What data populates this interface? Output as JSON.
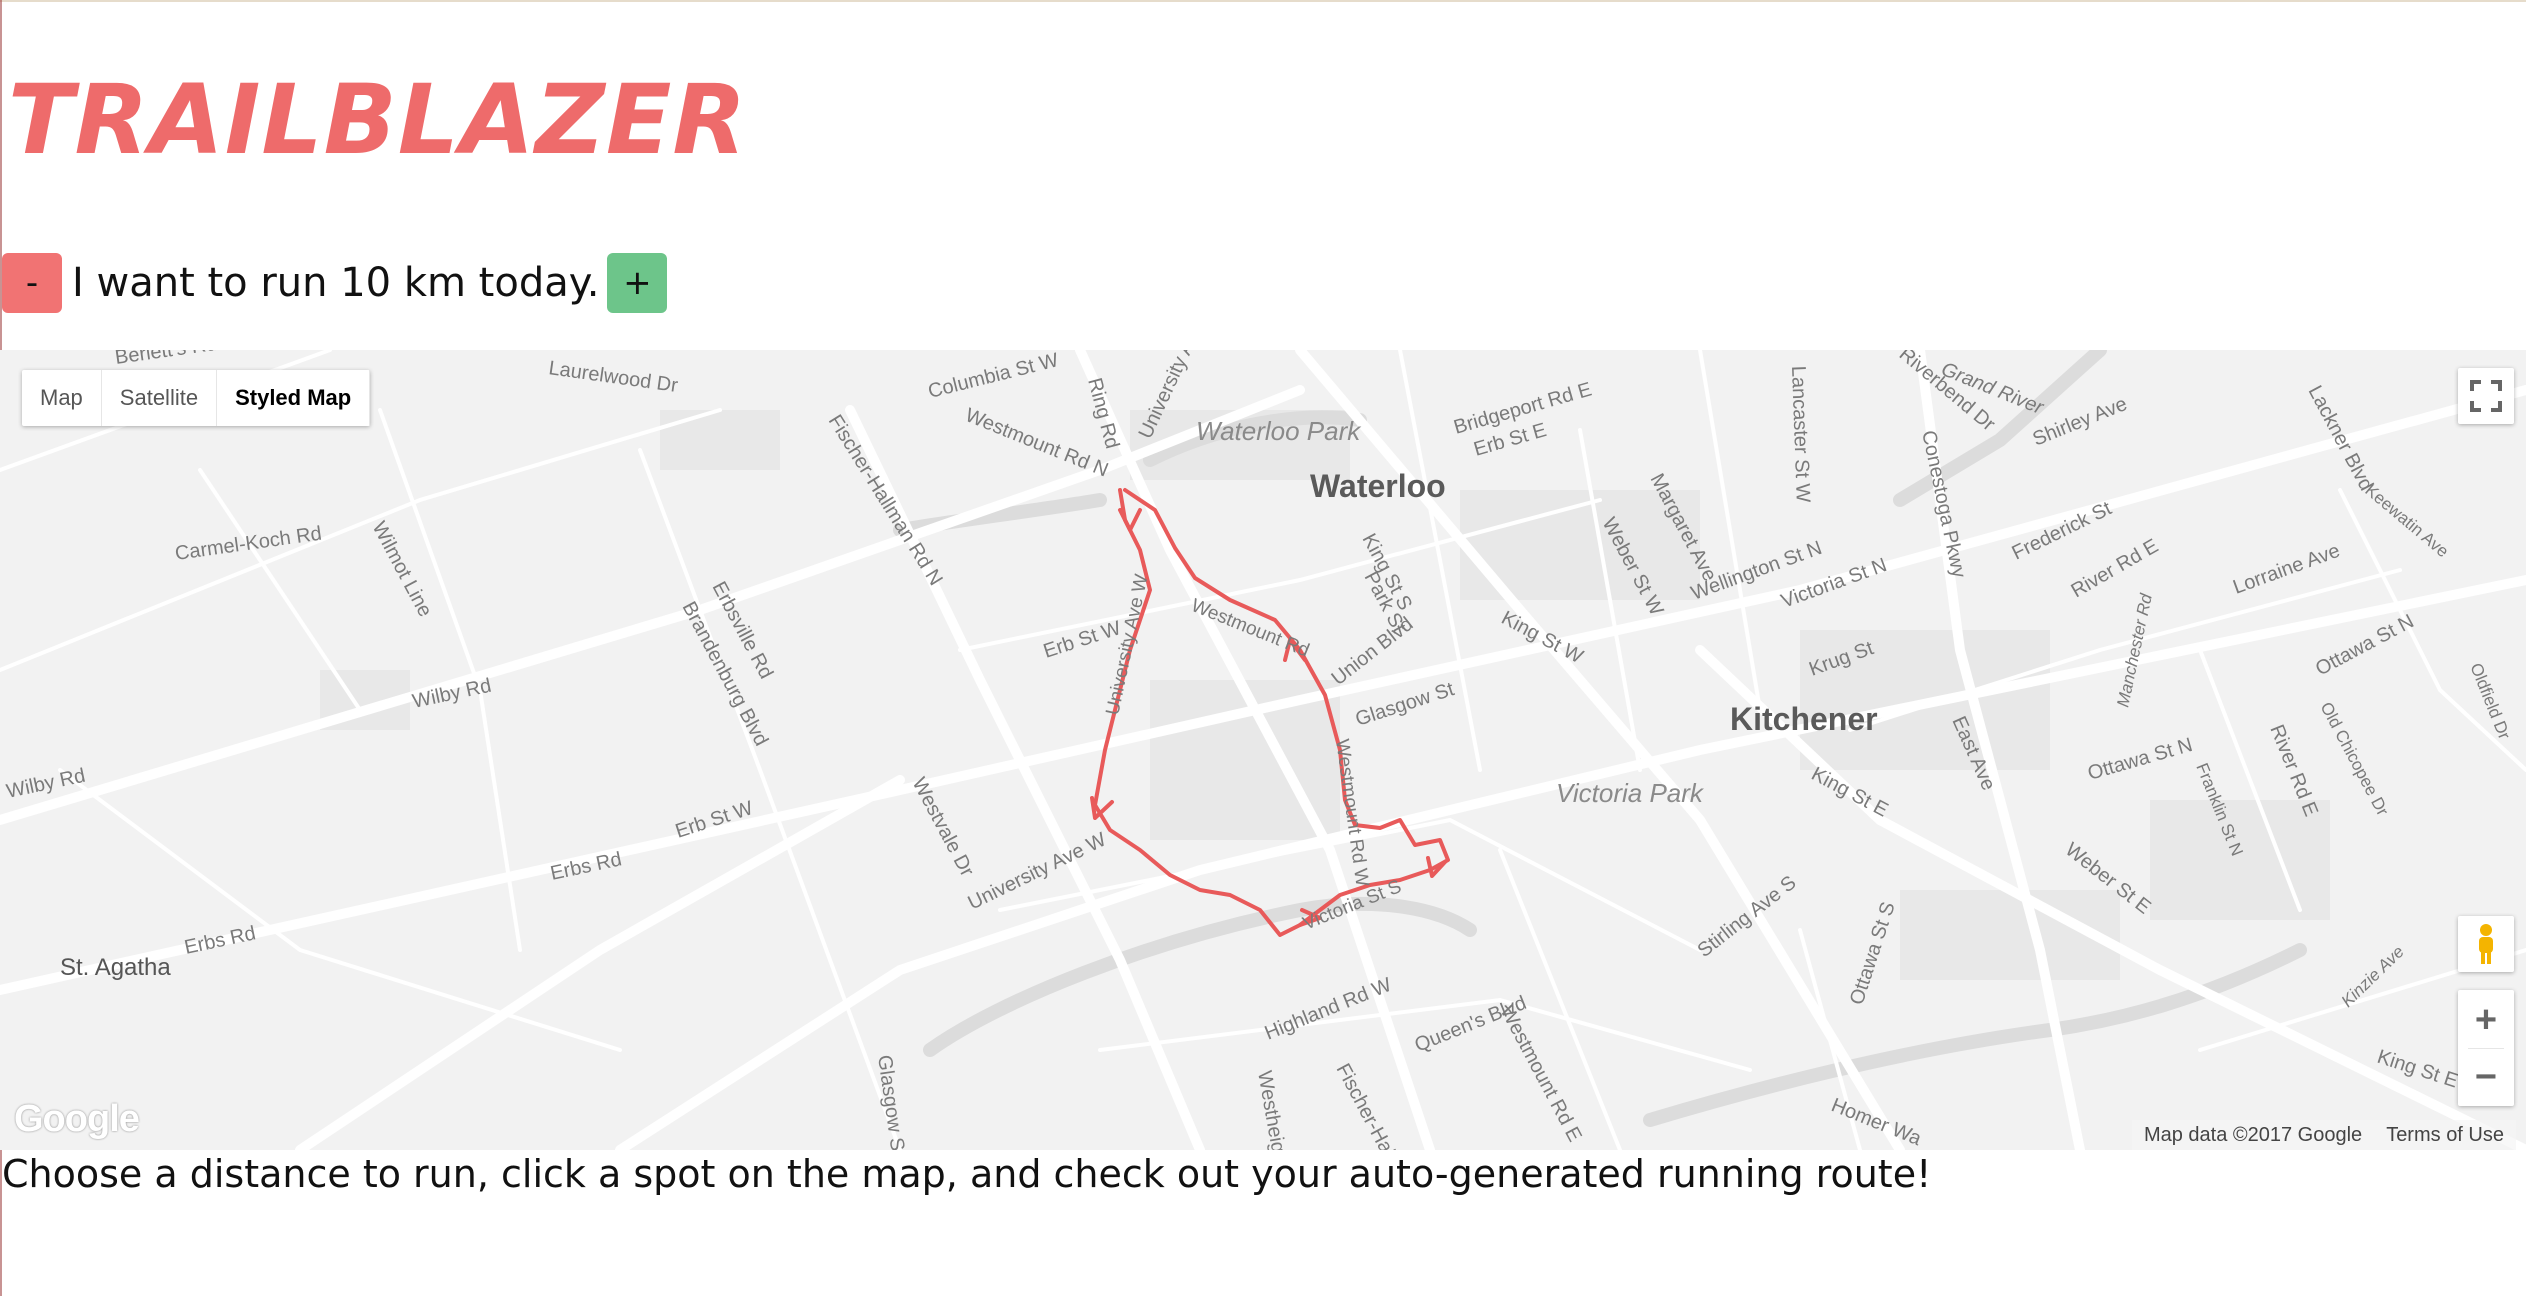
{
  "app": {
    "brand": "TRAILBLAZER"
  },
  "controls": {
    "decrease_label": "-",
    "increase_label": "+",
    "distance_text": "I want to run 10 km today."
  },
  "map": {
    "type_buttons": [
      "Map",
      "Satellite",
      "Styled Map"
    ],
    "active_type": "Styled Map",
    "zoom_in_label": "+",
    "zoom_out_label": "−",
    "logo_text": "Google",
    "attribution": "Map data ©2017 Google",
    "terms": "Terms of Use",
    "route_color": "#e85a5a",
    "labels": {
      "waterloo": "Waterloo",
      "kitchener": "Kitchener",
      "waterloo_park": "Waterloo Park",
      "victoria_park": "Victoria Park",
      "st_agatha": "St. Agatha",
      "berletts": "Berlett's Rd",
      "laurelwood": "Laurelwood Dr",
      "columbia": "Columbia St W",
      "ring_rd": "Ring Rd",
      "university_ave_e": "University Ave W",
      "westmount_rd_n": "Westmount Rd N",
      "fischer_hallman_n": "Fischer-Hallman Rd N",
      "carmel_koch": "Carmel-Koch Rd",
      "wilmot_line": "Wilmot Line",
      "erbsville": "Erbsville Rd",
      "brandenburg": "Brandenburg Blvd",
      "wilby_1": "Wilby Rd",
      "wilby_2": "Wilby Rd",
      "erb_st_w": "Erb St W",
      "erb_st_w2": "Erb St W",
      "erbs_rd": "Erbs Rd",
      "erbs_rd2": "Erbs Rd",
      "westvale": "Westvale Dr",
      "university_ave_w": "University Ave W",
      "glasgow_st": "Glasgow St",
      "glasgow_st2": "Glasgow St",
      "highland": "Highland Rd W",
      "queens": "Queen's Blvd",
      "westmount_rd_e": "Westmount Rd E",
      "fischer_hall": "Fischer-Hall",
      "westheights": "Westheig",
      "bridgeport": "Bridgeport Rd E",
      "erb_st_e": "Erb St E",
      "lancaster": "Lancaster St W",
      "riverbend": "Riverbend Dr",
      "grand_river": "Grand River",
      "shirley": "Shirley Ave",
      "lackner": "Lackner Blvd",
      "keewatin": "Keewatin Ave",
      "conestoga": "Conestoga Pkwy",
      "margaret": "Margaret Ave",
      "weber_n": "Weber St W",
      "wellington": "Wellington St N",
      "victoria_n": "Victoria St N",
      "frederick": "Frederick St",
      "river_rd_e": "River Rd E",
      "lorraine": "Lorraine Ave",
      "king_st_s": "King St S",
      "park_st": "Park St",
      "king_st_w": "King St W",
      "union_blvd": "Union Blvd",
      "glasgow_st_e": "Glasgow St",
      "manchester": "Manchester Rd",
      "krug": "Krug St",
      "ottawa_n": "Ottawa St N",
      "ottawa_n2": "Ottawa St N",
      "oldfield": "Oldfield Dr",
      "old_chicopee": "Old Chicopee Dr",
      "river_rd_e2": "River Rd E",
      "franklin": "Franklin St N",
      "king_st_e": "King St E",
      "east_ave": "East Ave",
      "weber_e": "Weber St E",
      "stirling": "Stirling Ave S",
      "ottawa_s": "Ottawa St S",
      "homer": "Homer Wa",
      "kinzie": "Kinzie Ave",
      "king_st_e2": "King St E",
      "westmount_rd_w": "Westmount Rd W",
      "victoria_st_s": "Victoria St S",
      "westmount_rd": "Westmount Rd",
      "university_ave_n": "University Ave W",
      "laurelwood_short": "Rd"
    }
  },
  "footer": {
    "instructions": "Choose a distance to run, click a spot on the map, and check out your auto-generated running route!"
  }
}
